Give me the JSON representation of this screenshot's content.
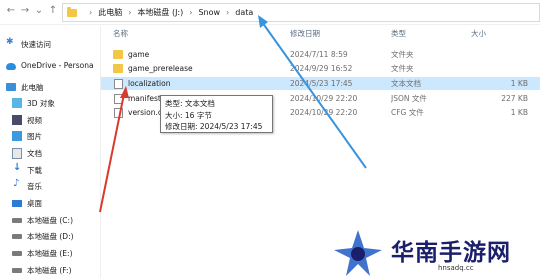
{
  "address": {
    "crumbs": [
      "此电脑",
      "本地磁盘 (J:)",
      "Snow",
      "data"
    ]
  },
  "sidebar": {
    "items": [
      {
        "label": "快速访问",
        "icon": "pin-icon"
      },
      {
        "label": "OneDrive - Persona",
        "icon": "cloud-icon"
      },
      {
        "label": "此电脑",
        "icon": "computer-icon"
      },
      {
        "label": "3D 对象",
        "icon": "3d-objects-icon"
      },
      {
        "label": "视频",
        "icon": "video-icon"
      },
      {
        "label": "图片",
        "icon": "pictures-icon"
      },
      {
        "label": "文档",
        "icon": "documents-icon"
      },
      {
        "label": "下载",
        "icon": "download-icon"
      },
      {
        "label": "音乐",
        "icon": "music-icon"
      },
      {
        "label": "桌面",
        "icon": "desktop-icon"
      },
      {
        "label": "本地磁盘 (C:)",
        "icon": "drive-icon"
      },
      {
        "label": "本地磁盘 (D:)",
        "icon": "drive-icon"
      },
      {
        "label": "本地磁盘 (E:)",
        "icon": "drive-icon"
      },
      {
        "label": "本地磁盘 (F:)",
        "icon": "drive-icon"
      }
    ]
  },
  "columns": {
    "name": "名称",
    "date": "修改日期",
    "type": "类型",
    "size": "大小"
  },
  "files": [
    {
      "name": "game",
      "date": "2024/7/11 8:59",
      "type": "文件夹",
      "size": "",
      "icon": "folder-icon"
    },
    {
      "name": "game_prerelease",
      "date": "2024/9/29 16:52",
      "type": "文件夹",
      "size": "",
      "icon": "folder-icon"
    },
    {
      "name": "localization",
      "date": "2024/5/23 17:45",
      "type": "文本文档",
      "size": "1 KB",
      "icon": "text-file-icon"
    },
    {
      "name": "manifest",
      "date": "2024/10/29 22:20",
      "type": "JSON 文件",
      "size": "227 KB",
      "icon": "file-icon"
    },
    {
      "name": "version.c",
      "date": "2024/10/29 22:20",
      "type": "CFG 文件",
      "size": "1 KB",
      "icon": "file-icon"
    }
  ],
  "tooltip": {
    "type": "类型: 文本文档",
    "size": "大小: 16 字节",
    "modified": "修改日期: 2024/5/23 17:45"
  },
  "watermark": {
    "text": "华南手游网",
    "url": "hnsadq.cc"
  },
  "colors": {
    "selection": "#cce8ff",
    "folder": "#f3c646",
    "arrow_red": "#d93a2b",
    "arrow_blue": "#3a93dd",
    "watermark": "#1b1e6a"
  }
}
